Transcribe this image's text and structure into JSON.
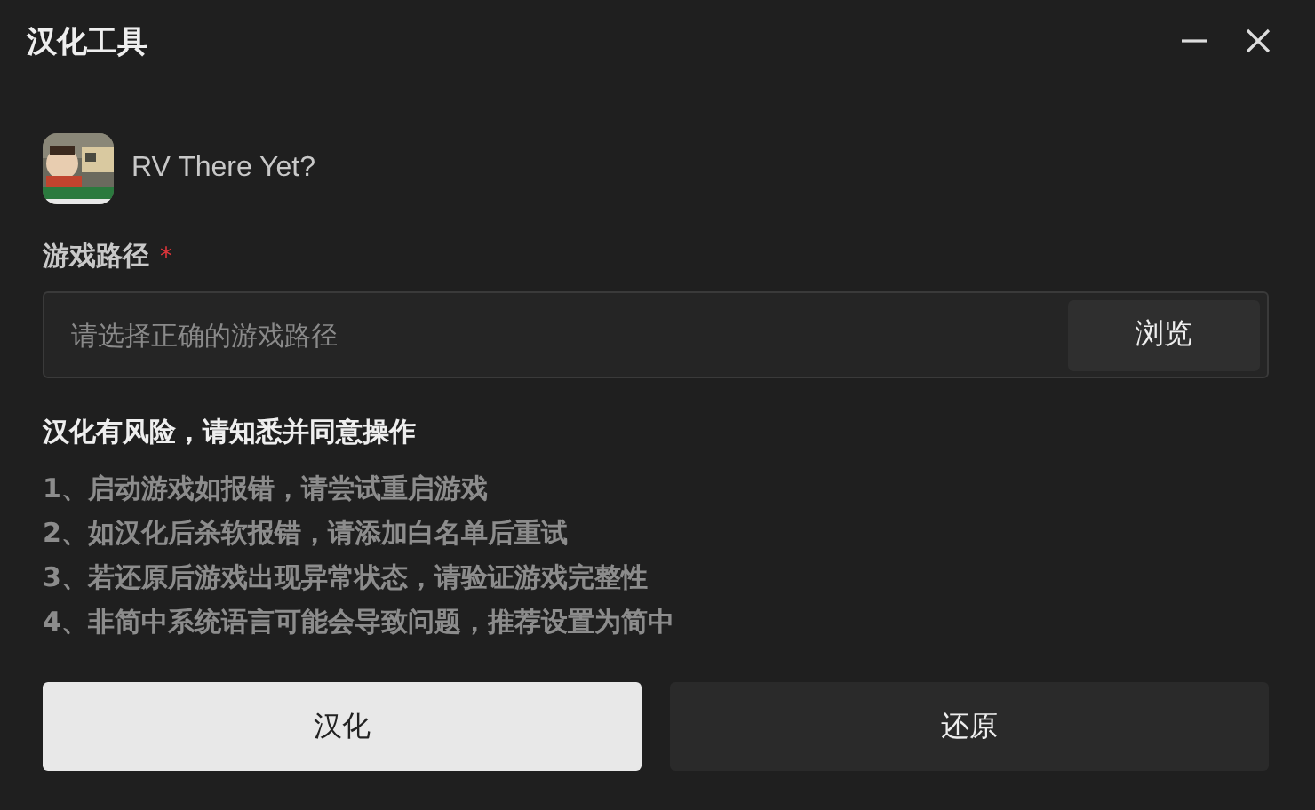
{
  "window": {
    "title": "汉化工具"
  },
  "game": {
    "name": "RV There Yet?"
  },
  "path_field": {
    "label": "游戏路径",
    "required_mark": "*",
    "placeholder": "请选择正确的游戏路径",
    "browse_button": "浏览"
  },
  "warning": {
    "title": "汉化有风险，请知悉并同意操作",
    "items": [
      "1、启动游戏如报错，请尝试重启游戏",
      "2、如汉化后杀软报错，请添加白名单后重试",
      "3、若还原后游戏出现异常状态，请验证游戏完整性",
      "4、非简中系统语言可能会导致问题，推荐设置为简中"
    ]
  },
  "buttons": [
    {
      "label": "汉化",
      "kind": "primary"
    },
    {
      "label": "还原",
      "kind": "secondary"
    }
  ]
}
